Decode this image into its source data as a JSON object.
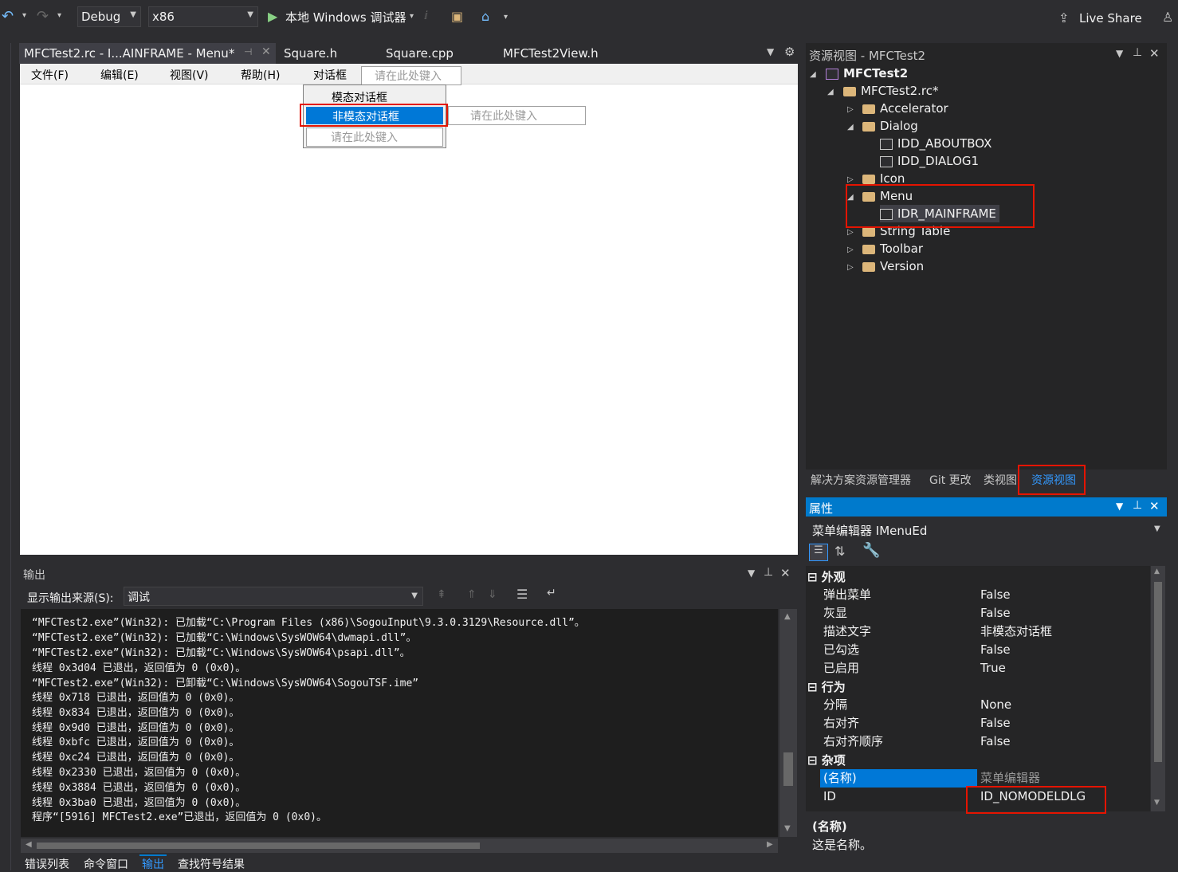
{
  "toolbar": {
    "config": "Debug",
    "platform": "x86",
    "run_label": "本地 Windows 调试器",
    "live_share": "Live Share"
  },
  "tabs": [
    {
      "label": "MFCTest2.rc - I...AINFRAME - Menu*",
      "active": true
    },
    {
      "label": "Square.h"
    },
    {
      "label": "Square.cpp"
    },
    {
      "label": "MFCTest2View.h"
    }
  ],
  "menu_editor": {
    "menubar": [
      "文件(F)",
      "编辑(E)",
      "视图(V)",
      "帮助(H)",
      "对话框"
    ],
    "type_here": "请在此处键入",
    "dropdown": {
      "items": [
        "模态对话框",
        "非模态对话框"
      ],
      "selected": "非模态对话框"
    }
  },
  "resource_view": {
    "title": "资源视图 - MFCTest2",
    "project": "MFCTest2",
    "rc_file": "MFCTest2.rc*",
    "nodes": [
      "Accelerator",
      "Dialog",
      "IDD_ABOUTBOX",
      "IDD_DIALOG1",
      "Icon",
      "Menu",
      "IDR_MAINFRAME",
      "String Table",
      "Toolbar",
      "Version"
    ]
  },
  "bottom_tabs_right": [
    "解决方案资源管理器",
    "Git 更改",
    "类视图",
    "资源视图"
  ],
  "properties": {
    "title": "属性",
    "object": "菜单编辑器 IMenuEd",
    "categories": {
      "appearance": "外观",
      "behavior": "行为",
      "misc": "杂项"
    },
    "rows": {
      "popup": {
        "k": "弹出菜单",
        "v": "False"
      },
      "grayed": {
        "k": "灰显",
        "v": "False"
      },
      "prompt": {
        "k": "描述文字",
        "v": "非模态对话框"
      },
      "checked": {
        "k": "已勾选",
        "v": "False"
      },
      "enabled": {
        "k": "已启用",
        "v": "True"
      },
      "separator": {
        "k": "分隔",
        "v": "None"
      },
      "right_justify": {
        "k": "右对齐",
        "v": "False"
      },
      "right_order": {
        "k": "右对齐顺序",
        "v": "False"
      },
      "name": {
        "k": "(名称)",
        "v": "菜单编辑器"
      },
      "id": {
        "k": "ID",
        "v": "ID_NOMODELDLG"
      }
    },
    "desc_title": "(名称)",
    "desc_text": "这是名称。"
  },
  "output": {
    "title": "输出",
    "source_label": "显示输出来源(S):",
    "source_value": "调试",
    "lines": [
      "“MFCTest2.exe”(Win32): 已加载“C:\\Program Files (x86)\\SogouInput\\9.3.0.3129\\Resource.dll”。",
      "“MFCTest2.exe”(Win32): 已加载“C:\\Windows\\SysWOW64\\dwmapi.dll”。",
      "“MFCTest2.exe”(Win32): 已加载“C:\\Windows\\SysWOW64\\psapi.dll”。",
      "线程 0x3d04 已退出，返回值为 0 (0x0)。",
      "“MFCTest2.exe”(Win32): 已卸载“C:\\Windows\\SysWOW64\\SogouTSF.ime”",
      "线程 0x718 已退出，返回值为 0 (0x0)。",
      "线程 0x834 已退出，返回值为 0 (0x0)。",
      "线程 0x9d0 已退出，返回值为 0 (0x0)。",
      "线程 0xbfc 已退出，返回值为 0 (0x0)。",
      "线程 0xc24 已退出，返回值为 0 (0x0)。",
      "线程 0x2330 已退出，返回值为 0 (0x0)。",
      "线程 0x3884 已退出，返回值为 0 (0x0)。",
      "线程 0x3ba0 已退出，返回值为 0 (0x0)。",
      "程序“[5916] MFCTest2.exe”已退出，返回值为 0 (0x0)。"
    ]
  },
  "bottom_tabs": [
    "错误列表",
    "命令窗口",
    "输出",
    "查找符号结果"
  ],
  "colors": {
    "accent": "#007acc",
    "highlight_red": "#e51400",
    "selected": "#0078d7"
  }
}
